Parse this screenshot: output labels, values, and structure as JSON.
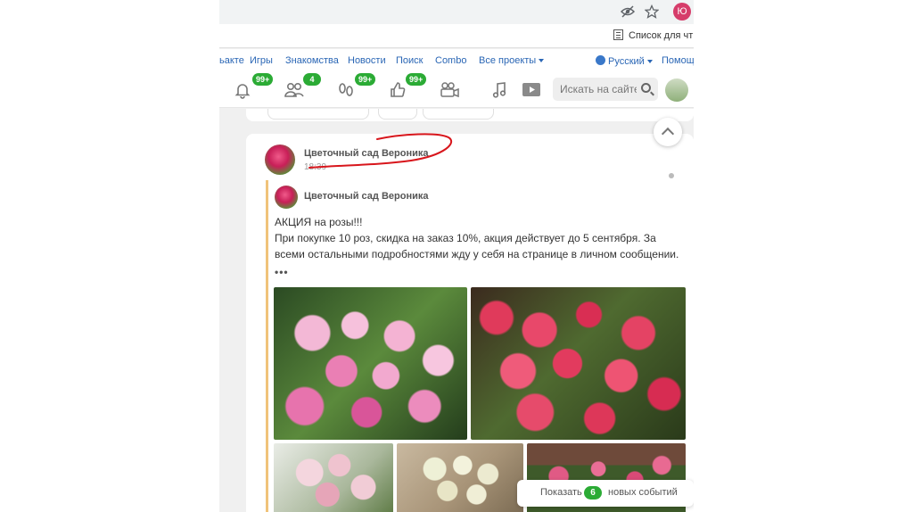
{
  "browser": {
    "profile_initial": "Ю",
    "reading_list": "Список для чт",
    "icons": [
      "eye-off-icon",
      "star-icon"
    ]
  },
  "topnav": {
    "items": [
      "ьакте",
      "Игры",
      "Знакомства",
      "Новости",
      "Поиск",
      "Combo",
      "Все проекты"
    ],
    "language": "Русский",
    "help": "Помощь"
  },
  "toolbar": {
    "notifications_badge": "99+",
    "friends_badge": "4",
    "guests_badge": "99+",
    "likes_badge": "99+",
    "search_placeholder": "Искать на сайте",
    "icons": [
      "bell-icon",
      "friends-icon",
      "footprints-icon",
      "thumbs-up-icon",
      "video-camera-icon",
      "music-icon",
      "play-icon"
    ]
  },
  "post": {
    "author": "Цветочный сад Вероника",
    "time": "18:39",
    "repost_author": "Цветочный сад Вероника",
    "text_line1": "АКЦИЯ на розы!!!",
    "text_line2": "При покупке 10 роз, скидка на заказ 10%, акция действует до 5 сентября. За всеми остальными подробностями жду у себя на странице в личном сообщении.",
    "more": "•••"
  },
  "events": {
    "prefix": "Показать",
    "count": "6",
    "suffix": "новых событий"
  },
  "colors": {
    "link": "#2a66b5",
    "badge": "#2bab35",
    "profile": "#d63c6a",
    "annotation": "#d8161c"
  }
}
